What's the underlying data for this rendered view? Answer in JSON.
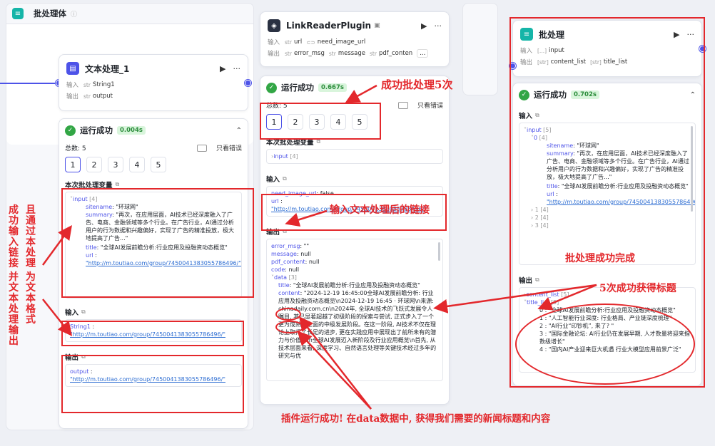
{
  "batch_body": {
    "title": "批处理体",
    "info_icon": "info-icon"
  },
  "text_node": {
    "title": "文本处理_1",
    "input_label": "输入",
    "output_label": "输出",
    "input_type": "str",
    "input_name": "String1",
    "output_type": "str",
    "output_name": "output"
  },
  "text_result": {
    "status": "运行成功",
    "time": "0.004s",
    "total": "总数: 5",
    "only_errors": "只看错误",
    "pages": [
      "1",
      "2",
      "3",
      "4",
      "5"
    ],
    "section_batch_vars": "本次批处理变量",
    "input_key": "input",
    "input_count": "[4]",
    "sitename_key": "sitename",
    "sitename_val": ": \"环球网\"",
    "summary_key": "summary",
    "summary_val": ": \"再次，在应用层面，AI技术已经深度融入了广告、电商、金融领域等多个行业。在广告行业，AI通过分析用户的行为数据和兴趣偏好，实现了广告的精准投放，极大地提高了广告...\"",
    "title_key": "title",
    "title_val": ": \"全球AI发展前瞻分析:行业应用及投融资动态概览\"",
    "url_key": "url",
    "url_val": "\"http://m.toutiao.com/group/7450041383055786496/\"",
    "section_input": "输入",
    "string1_key": "String1",
    "string1_val": "\"http://m.toutiao.com/group/7450041383055786496/\"",
    "section_output": "输出",
    "output_key": "output",
    "output_val": "\"http://m.toutiao.com/group/7450041383055786496/\""
  },
  "link_node": {
    "title": "LinkReaderPlugin",
    "input_label": "输入",
    "output_label": "输出",
    "in1_type": "str",
    "in1_name": "url",
    "in2_name": "need_image_url",
    "out1_type": "str",
    "out1_name": "error_msg",
    "out2_type": "str",
    "out2_name": "message",
    "out3_type": "str",
    "out3_name": "pdf_conten",
    "more": "..."
  },
  "link_result": {
    "status": "运行成功",
    "time": "0.667s",
    "total": "总数: 5",
    "only_errors": "只看错误",
    "pages": [
      "1",
      "2",
      "3",
      "4",
      "5"
    ],
    "section_batch_vars": "本次批处理变量",
    "input_key": "input",
    "input_count": "[4]",
    "section_input": "输入",
    "need_image_key": "need_image_url",
    "need_image_val": ": false",
    "url_key": "url",
    "url_val": "\"http://m.toutiao.com/group/7450041383055786496/\"",
    "section_output": "输出",
    "error_msg_key": "error_msg",
    "error_msg_val": ": \"\"",
    "message_key": "message",
    "message_val": ": null",
    "pdf_key": "pdf_content",
    "pdf_val": ": null",
    "code_key": "code",
    "code_val": ": null",
    "data_key": "data",
    "data_count": "[3]",
    "title_key": "title",
    "title_val": ": \"全球AI发展前瞻分析:行业应用及投融资动态概览\"",
    "content_key": "content",
    "content_val": ": \"2024-12-19 16:45:00全球AI发展前瞻分析: 行业应用及投融资动态概览\\n2024-12-19 16:45 · 环球网\\n来源: chinadaily.com.cn\\n2024年, 全球AI技术的飞跃式发展令人瞩目, 其已显著超越了初级阶段的探索与尝试, 正式步入了一个更为成熟、全面的中级发展阶段。在这一阶段, AI技术不仅在理论上取得了长足的进步, 更在实践应用中展现出了前所未有的潜力与价值。\\n全球AI发展迈入新阶段及行业应用概览\\n首先, 从技术层面来看, 深度学习、自然语言处理等关键技术经过多年的研究与优"
  },
  "batch_node": {
    "title": "批处理",
    "input_label": "输入",
    "output_label": "输出",
    "in_type": "[...]",
    "in_name": "input",
    "out1_type": "[str]",
    "out1_name": "content_list",
    "out2_type": "[str]",
    "out2_name": "title_list"
  },
  "batch_result": {
    "status": "运行成功",
    "time": "0.702s",
    "section_input": "输入",
    "input_key": "input",
    "input_count": "[5]",
    "item0_key": "0",
    "item0_count": "[4]",
    "sitename_key": "sitename",
    "sitename_val": ": \"环球网\"",
    "summary_key": "summary",
    "summary_val": ": \"再次，在应用层面，AI技术已经深度融入了广告、电商、金融领域等多个行业。在广告行业，AI通过分析用户的行为数据和兴趣偏好，实现了广告的精准投放，极大地提高了广告...\"",
    "title_key": "title",
    "title_val": ": \"全球AI发展前瞻分析:行业应用及投融资动态概览\"",
    "url_key": "url",
    "url_val": "\"http://m.toutiao.com/group/7450041383055786496/\"",
    "item1": "1 [4]",
    "item2": "2 [4]",
    "item3": "3 [4]",
    "section_output": "输出",
    "content_list_key": "content_list",
    "content_list_count": "[5]",
    "title_list_key": "title_list",
    "title_list_count": "[5]",
    "titles": [
      "0 : \"全球AI发展前瞻分析:行业应用及投融资动态概览\"",
      "1 : \"人工智能行业深度: 行业格局、产业链深度梳理\"",
      "2 : \"AI行业“印钞机”, 来了? \"",
      "3 : \"国际金融论坛: AI行业仍在发展早期, 人才数量将迎来指数级增长\"",
      "4 : \"国内AI产业迎来巨大机遇 行业大模型应用前景广泛\""
    ]
  },
  "annotations": {
    "batch5": "成功批处理5次",
    "link_input": "输入文本处理后的链接",
    "left_vertical": [
      "成功输入链接",
      "且通过本处理",
      "并文本处理输出",
      "为文本格式"
    ],
    "batch_done": "批处理成功完成",
    "titles5": "5次成功获得标题",
    "plugin_ok": "插件运行成功! 在data数据中, 获得我们需要的新闻标题和内容"
  },
  "colors": {
    "accent": "#4d53e8",
    "success": "#32a645",
    "annotation": "#e3282c"
  }
}
